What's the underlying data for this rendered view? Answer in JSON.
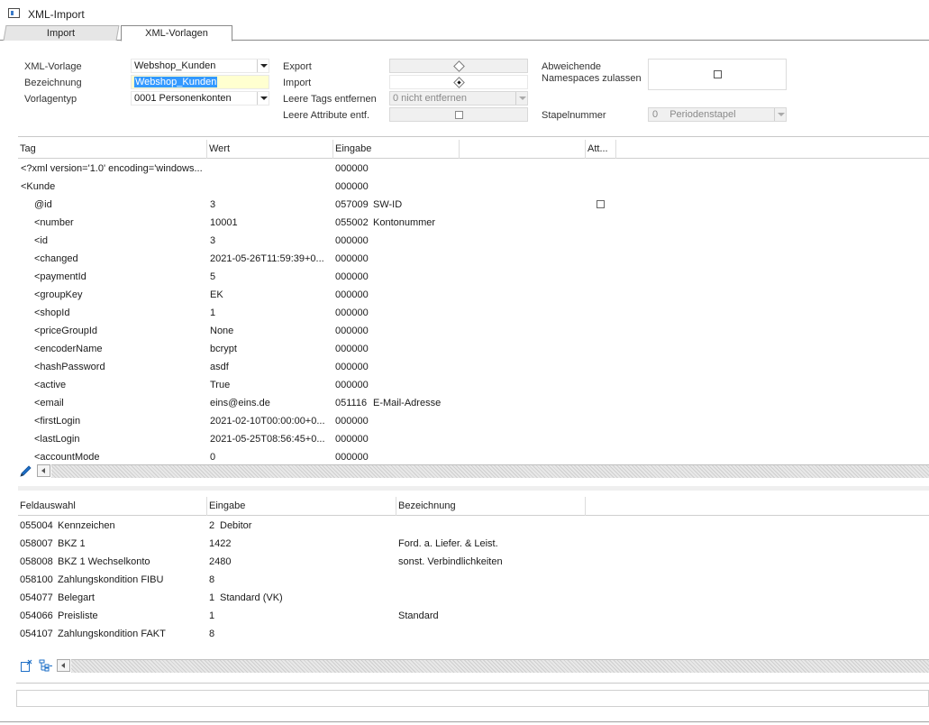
{
  "window": {
    "title": "XML-Import"
  },
  "tabs": [
    {
      "label": "Import"
    },
    {
      "label": "XML-Vorlagen"
    }
  ],
  "form": {
    "xml_vorlage": {
      "label": "XML-Vorlage",
      "value": "Webshop_Kunden"
    },
    "bezeichnung": {
      "label": "Bezeichnung",
      "value": "Webshop_Kunden"
    },
    "vorlagentyp": {
      "label": "Vorlagentyp",
      "value": "0001 Personenkonten"
    },
    "export": {
      "label": "Export"
    },
    "import": {
      "label": "Import"
    },
    "leere_tags": {
      "label": "Leere Tags entfernen",
      "value": "0 nicht entfernen"
    },
    "leere_attribute": {
      "label": "Leere Attribute entf."
    },
    "namespaces": {
      "label_line1": "Abweichende",
      "label_line2": "Namespaces zulassen"
    },
    "stapelnummer": {
      "label": "Stapelnummer",
      "number": "0",
      "text": "Periodenstapel"
    }
  },
  "tag_grid": {
    "columns": [
      "Tag",
      "Wert",
      "Eingabe",
      "",
      "Att..."
    ],
    "rows": [
      {
        "tag": "<?xml version='1.0' encoding='windows...",
        "wert": "",
        "eingabe_code": "000000",
        "eingabe_text": "",
        "indent": 0
      },
      {
        "tag": "<Kunde",
        "wert": "",
        "eingabe_code": "000000",
        "eingabe_text": "",
        "indent": 0
      },
      {
        "tag": "@id",
        "wert": "3",
        "eingabe_code": "057009",
        "eingabe_text": "SW-ID",
        "indent": 1,
        "att_check": true
      },
      {
        "tag": "<number",
        "wert": "10001",
        "eingabe_code": "055002",
        "eingabe_text": "Kontonummer",
        "indent": 1
      },
      {
        "tag": "<id",
        "wert": "3",
        "eingabe_code": "000000",
        "eingabe_text": "",
        "indent": 1
      },
      {
        "tag": "<changed",
        "wert": "2021-05-26T11:59:39+0...",
        "eingabe_code": "000000",
        "eingabe_text": "",
        "indent": 1
      },
      {
        "tag": "<paymentId",
        "wert": "5",
        "eingabe_code": "000000",
        "eingabe_text": "",
        "indent": 1
      },
      {
        "tag": "<groupKey",
        "wert": "EK",
        "eingabe_code": "000000",
        "eingabe_text": "",
        "indent": 1
      },
      {
        "tag": "<shopId",
        "wert": "1",
        "eingabe_code": "000000",
        "eingabe_text": "",
        "indent": 1
      },
      {
        "tag": "<priceGroupId",
        "wert": "None",
        "eingabe_code": "000000",
        "eingabe_text": "",
        "indent": 1
      },
      {
        "tag": "<encoderName",
        "wert": "bcrypt",
        "eingabe_code": "000000",
        "eingabe_text": "",
        "indent": 1
      },
      {
        "tag": "<hashPassword",
        "wert": "asdf",
        "eingabe_code": "000000",
        "eingabe_text": "",
        "indent": 1
      },
      {
        "tag": "<active",
        "wert": "True",
        "eingabe_code": "000000",
        "eingabe_text": "",
        "indent": 1
      },
      {
        "tag": "<email",
        "wert": "eins@eins.de",
        "eingabe_code": "051116",
        "eingabe_text": "E-Mail-Adresse",
        "indent": 1
      },
      {
        "tag": "<firstLogin",
        "wert": "2021-02-10T00:00:00+0...",
        "eingabe_code": "000000",
        "eingabe_text": "",
        "indent": 1
      },
      {
        "tag": "<lastLogin",
        "wert": "2021-05-25T08:56:45+0...",
        "eingabe_code": "000000",
        "eingabe_text": "",
        "indent": 1
      },
      {
        "tag": "<accountMode",
        "wert": "0",
        "eingabe_code": "000000",
        "eingabe_text": "",
        "indent": 1
      }
    ]
  },
  "field_grid": {
    "columns": [
      "Feldauswahl",
      "Eingabe",
      "Bezeichnung"
    ],
    "rows": [
      {
        "code": "055004",
        "name": "Kennzeichen",
        "eingabe_num": "2",
        "eingabe_text": "Debitor",
        "bezeichnung": ""
      },
      {
        "code": "058007",
        "name": "BKZ 1",
        "eingabe_num": "1422",
        "eingabe_text": "",
        "bezeichnung": "Ford. a. Liefer. & Leist."
      },
      {
        "code": "058008",
        "name": "BKZ 1 Wechselkonto",
        "eingabe_num": "2480",
        "eingabe_text": "",
        "bezeichnung": "sonst. Verbindlichkeiten"
      },
      {
        "code": "058100",
        "name": "Zahlungskondition FIBU",
        "eingabe_num": "8",
        "eingabe_text": "",
        "bezeichnung": ""
      },
      {
        "code": "054077",
        "name": "Belegart",
        "eingabe_num": "1",
        "eingabe_text": "Standard (VK)",
        "bezeichnung": ""
      },
      {
        "code": "054066",
        "name": "Preisliste",
        "eingabe_num": "1",
        "eingabe_text": "",
        "bezeichnung": "Standard"
      },
      {
        "code": "054107",
        "name": "Zahlungskondition FAKT",
        "eingabe_num": "8",
        "eingabe_text": "",
        "bezeichnung": ""
      }
    ]
  },
  "icons": {
    "edit": "pencil-icon",
    "new_entry": "new-entry-icon",
    "tree": "tree-mapping-icon"
  }
}
